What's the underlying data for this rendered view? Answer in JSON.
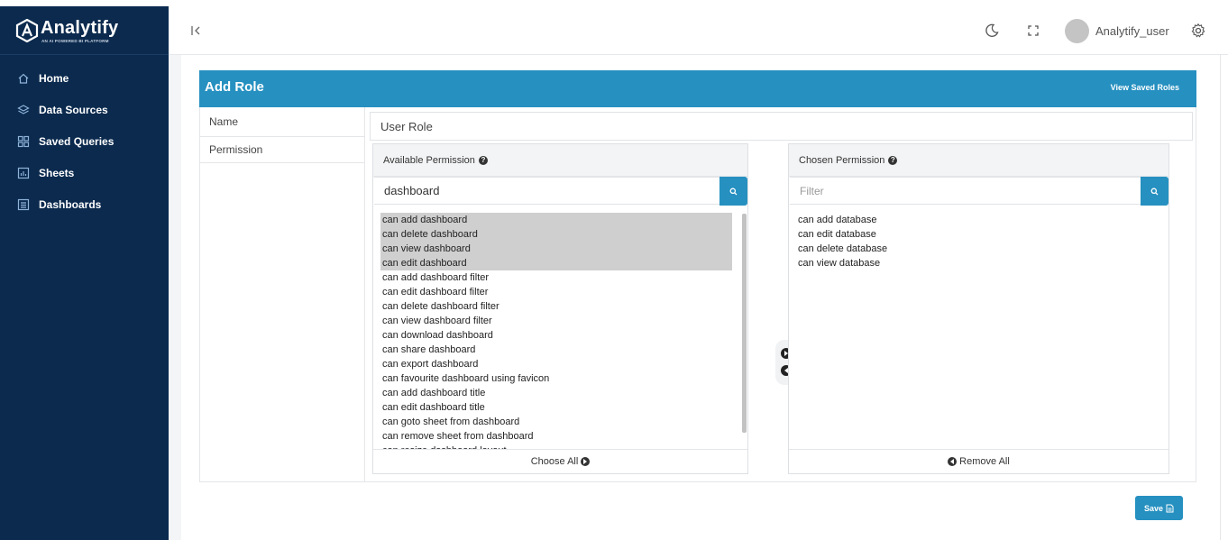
{
  "brand": {
    "name": "Analytify",
    "tagline": "AN AI POWERED BI PLATFORM"
  },
  "sidebar": {
    "items": [
      {
        "label": "Home",
        "icon": "home-icon"
      },
      {
        "label": "Data Sources",
        "icon": "layers-icon"
      },
      {
        "label": "Saved Queries",
        "icon": "grid-icon"
      },
      {
        "label": "Sheets",
        "icon": "chart-icon"
      },
      {
        "label": "Dashboards",
        "icon": "list-icon"
      }
    ]
  },
  "header": {
    "username": "Analytify_user",
    "icons": [
      "collapse-icon",
      "moon-icon",
      "fullscreen-icon",
      "gear-icon"
    ]
  },
  "page": {
    "title": "Add Role",
    "view_saved_label": "View Saved Roles",
    "labels": {
      "name": "Name",
      "permission": "Permission"
    },
    "role_name_value": "User Role",
    "save_label": "Save"
  },
  "available": {
    "title": "Available Permission",
    "search_value": "dashboard",
    "items": [
      {
        "label": "can add dashboard",
        "selected": true
      },
      {
        "label": "can delete dashboard",
        "selected": true
      },
      {
        "label": "can view dashboard",
        "selected": true
      },
      {
        "label": "can edit dashboard",
        "selected": true
      },
      {
        "label": "can add dashboard filter",
        "selected": false
      },
      {
        "label": "can edit dashboard filter",
        "selected": false
      },
      {
        "label": "can delete dashboard filter",
        "selected": false
      },
      {
        "label": "can view dashboard filter",
        "selected": false
      },
      {
        "label": "can download dashboard",
        "selected": false
      },
      {
        "label": "can share dashboard",
        "selected": false
      },
      {
        "label": "can export dashboard",
        "selected": false
      },
      {
        "label": "can favourite dashboard using favicon",
        "selected": false
      },
      {
        "label": "can add dashboard title",
        "selected": false
      },
      {
        "label": "can edit dashboard title",
        "selected": false
      },
      {
        "label": "can goto sheet from dashboard",
        "selected": false
      },
      {
        "label": "can remove sheet from dashboard",
        "selected": false
      },
      {
        "label": "can resize dashboard layout",
        "selected": false
      }
    ],
    "footer_label": "Choose All"
  },
  "chosen": {
    "title": "Chosen Permission",
    "search_placeholder": "Filter",
    "items": [
      {
        "label": "can add database"
      },
      {
        "label": "can edit database"
      },
      {
        "label": "can delete database"
      },
      {
        "label": "can view database"
      }
    ],
    "footer_label": "Remove All"
  },
  "colors": {
    "sidebar_bg": "#0b2a4e",
    "accent": "#2690c0",
    "selected_row": "#cfcfcf"
  }
}
